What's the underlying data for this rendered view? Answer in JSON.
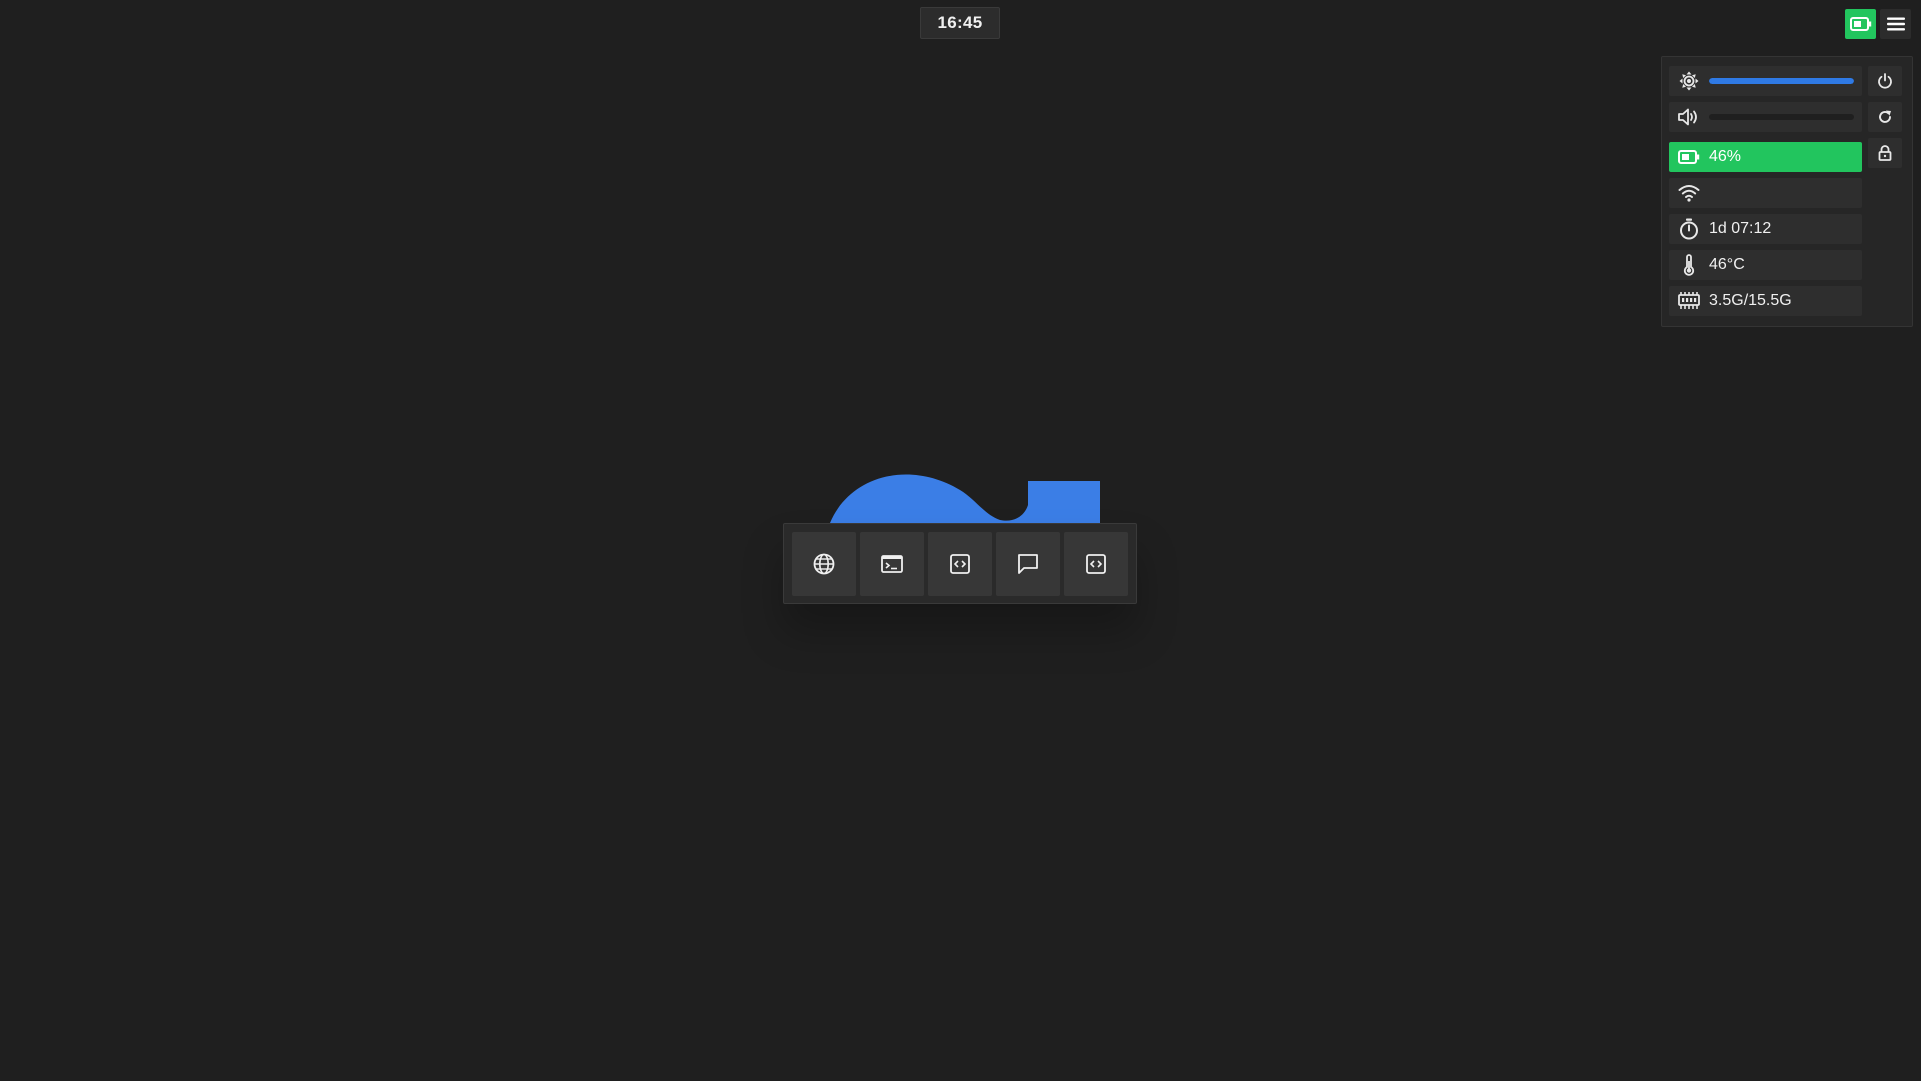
{
  "topbar": {
    "clock": "16:45",
    "battery_button_icon": "battery-icon",
    "menu_button_icon": "hamburger-menu-icon"
  },
  "quick_settings": {
    "brightness": {
      "icon": "brightness-icon",
      "level": 1.0
    },
    "volume": {
      "icon": "volume-icon",
      "level": 0.0
    },
    "battery": {
      "icon": "battery-icon",
      "label": "46%",
      "color": "#22c55e"
    },
    "wifi": {
      "icon": "wifi-icon",
      "label": ""
    },
    "uptime": {
      "icon": "timer-icon",
      "label": "1d 07:12"
    },
    "temperature": {
      "icon": "thermometer-icon",
      "label": "46°C"
    },
    "memory": {
      "icon": "memory-icon",
      "label": "3.5G/15.5G"
    },
    "actions": [
      {
        "name": "power-button",
        "icon": "power-icon"
      },
      {
        "name": "restart-button",
        "icon": "refresh-icon"
      },
      {
        "name": "lock-button",
        "icon": "lock-icon"
      }
    ]
  },
  "launcher": {
    "items": [
      {
        "name": "browser-launcher",
        "icon": "globe-icon"
      },
      {
        "name": "terminal-launcher",
        "icon": "terminal-icon"
      },
      {
        "name": "code-editor-launcher",
        "icon": "code-icon"
      },
      {
        "name": "chat-launcher",
        "icon": "chat-icon"
      },
      {
        "name": "code-launcher-2",
        "icon": "code-icon"
      }
    ]
  },
  "colors": {
    "background": "#1f1f1f",
    "accent_blue": "#2f7ae5",
    "battery_green": "#22c55e",
    "panel": "#262626"
  }
}
